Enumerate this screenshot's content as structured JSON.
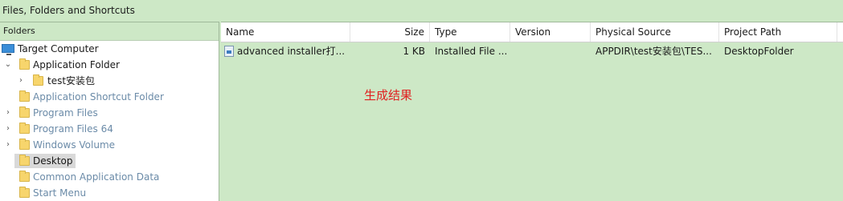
{
  "window": {
    "title": "Files, Folders and Shortcuts"
  },
  "folders_pane": {
    "header": "Folders",
    "items": [
      {
        "label": "Target Computer",
        "icon": "computer-icon"
      },
      {
        "label": "Application Folder",
        "icon": "folder-icon",
        "expanded": true
      },
      {
        "label": "test安装包",
        "icon": "folder-icon"
      },
      {
        "label": "Application Shortcut Folder",
        "icon": "folder-icon"
      },
      {
        "label": "Program Files",
        "icon": "folder-icon"
      },
      {
        "label": "Program Files 64",
        "icon": "folder-icon"
      },
      {
        "label": "Windows Volume",
        "icon": "folder-icon"
      },
      {
        "label": "Desktop",
        "icon": "folder-icon",
        "selected": true
      },
      {
        "label": "Common Application Data",
        "icon": "folder-icon"
      },
      {
        "label": "Start Menu",
        "icon": "folder-icon"
      }
    ]
  },
  "files_table": {
    "columns": [
      "Name",
      "Size",
      "Type",
      "Version",
      "Physical Source",
      "Project Path"
    ],
    "rows": [
      {
        "name": "advanced installer打...",
        "size": "1 KB",
        "type": "Installed File ...",
        "version": "",
        "physical_source": "APPDIR\\test安装包\\TES...",
        "project_path": "DesktopFolder"
      }
    ]
  },
  "annotation": {
    "text": "生成结果",
    "color": "#e02020"
  },
  "colors": {
    "background": "#cde8c6",
    "selected": "#d9d9d9",
    "folder": "#f7d56c"
  }
}
